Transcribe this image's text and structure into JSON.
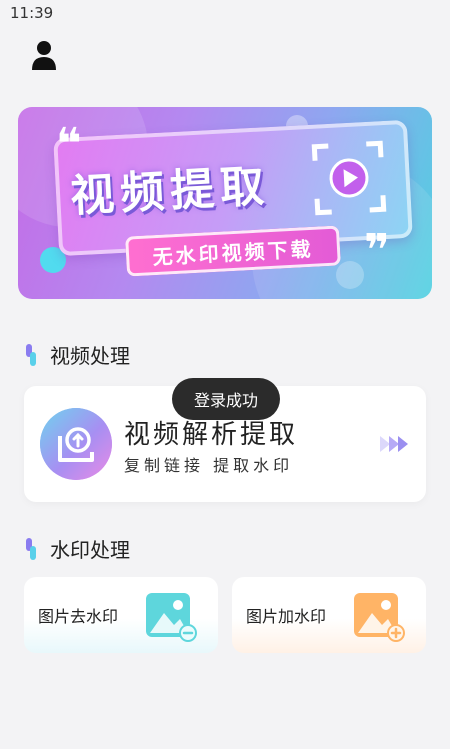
{
  "status_bar": {
    "time": "11:39"
  },
  "banner": {
    "title": "视频提取",
    "subtitle": "无水印视频下载"
  },
  "sections": {
    "video": {
      "title": "视频处理"
    },
    "watermark": {
      "title": "水印处理"
    }
  },
  "parse_card": {
    "title": "视频解析提取",
    "subtitle": "复制链接  提取水印"
  },
  "toast": {
    "text": "登录成功"
  },
  "watermark_cards": [
    {
      "label": "图片去水印"
    },
    {
      "label": "图片加水印"
    }
  ],
  "colors": {
    "accent_pink": "#e35bd6",
    "accent_purple": "#a78ff2",
    "accent_cyan": "#4fd1e0",
    "page_bg": "#f3f3f5"
  },
  "icons": [
    "profile-icon",
    "play-icon",
    "double-arrow-icon",
    "image-remove-icon",
    "image-add-icon"
  ]
}
